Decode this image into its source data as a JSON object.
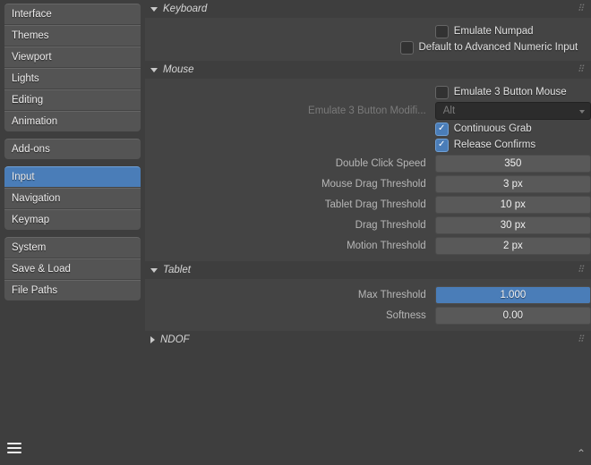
{
  "sidebar": {
    "groups": [
      [
        "Interface",
        "Themes",
        "Viewport",
        "Lights",
        "Editing",
        "Animation"
      ],
      [
        "Add-ons"
      ],
      [
        "Input",
        "Navigation",
        "Keymap"
      ],
      [
        "System",
        "Save & Load",
        "File Paths"
      ]
    ],
    "active": "Input"
  },
  "sections": {
    "keyboard": {
      "title": "Keyboard",
      "emulate_numpad_label": "Emulate Numpad",
      "emulate_numpad": false,
      "advanced_numeric_label": "Default to Advanced Numeric Input",
      "advanced_numeric": false
    },
    "mouse": {
      "title": "Mouse",
      "emulate_3button_label": "Emulate 3 Button Mouse",
      "emulate_3button": false,
      "modifier_label": "Emulate 3 Button Modifi...",
      "modifier_value": "Alt",
      "continuous_grab_label": "Continuous Grab",
      "continuous_grab": true,
      "release_confirms_label": "Release Confirms",
      "release_confirms": true,
      "dblclick_label": "Double Click Speed",
      "dblclick_value": "350",
      "mouse_drag_label": "Mouse Drag Threshold",
      "mouse_drag_value": "3 px",
      "tablet_drag_label": "Tablet Drag Threshold",
      "tablet_drag_value": "10 px",
      "drag_label": "Drag Threshold",
      "drag_value": "30 px",
      "motion_label": "Motion Threshold",
      "motion_value": "2 px"
    },
    "tablet": {
      "title": "Tablet",
      "max_threshold_label": "Max Threshold",
      "max_threshold_value": "1.000",
      "max_threshold_fill": "100%",
      "softness_label": "Softness",
      "softness_value": "0.00",
      "softness_fill": "0%"
    },
    "ndof": {
      "title": "NDOF"
    }
  }
}
